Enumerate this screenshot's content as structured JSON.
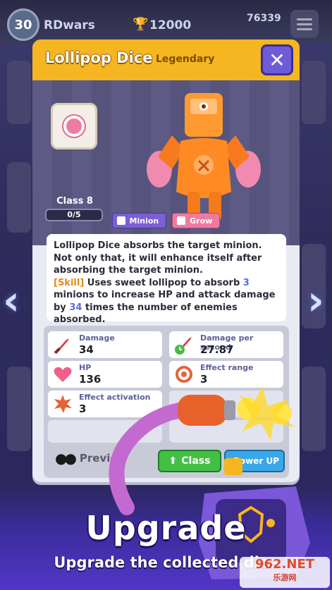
{
  "topbar": {
    "level": "30",
    "player_name": "RDwars",
    "trophies": "12000",
    "coins": "76339",
    "icons": [
      "trophy-icon",
      "coin-icon",
      "menu-icon"
    ]
  },
  "dialog": {
    "title": "Lollipop Dice",
    "rarity": "Legendary",
    "class_label": "Class 8",
    "class_progress": "0/5",
    "progress_fraction": 0,
    "tags": [
      {
        "label": "Minion",
        "color": "#7a5fd8"
      },
      {
        "label": "Grow",
        "color": "#ef7aa0"
      }
    ],
    "description": {
      "line1": "Lollipop Dice absorbs the target minion. Not only that, it will enhance itself after absorbing the target minion.",
      "skill_tag": "[Skill]",
      "skill_pre": " Uses sweet lollipop to absorb ",
      "skill_num1": "3",
      "skill_mid": " minions to increase HP and attack damage by ",
      "skill_num2": "34",
      "skill_post": " times the number of enemies absorbed."
    },
    "stats": [
      {
        "label": "Damage",
        "value": "34",
        "icon": "sword-icon"
      },
      {
        "label": "Damage per second",
        "value": "27.87",
        "icon": "sword-clock-icon"
      },
      {
        "label": "HP",
        "value": "136",
        "icon": "heart-icon"
      },
      {
        "label": "Effect range",
        "value": "3",
        "icon": "target-icon"
      },
      {
        "label": "Effect activation",
        "value": "3",
        "icon": "burst-icon"
      }
    ],
    "buttons": {
      "preview": "Preview",
      "class": "Class",
      "power_up": "Power UP"
    }
  },
  "banner": {
    "title": "Upgrade",
    "subtitle": "Upgrade the collected dice"
  },
  "watermark": {
    "main": "962.NET",
    "sub": "乐游网"
  },
  "colors": {
    "header": "#f5b622",
    "close_button": "#6d5bd8",
    "class_button": "#43c043",
    "power_button": "#3aa7e8",
    "skill_highlight": "#e08a1a",
    "number_highlight": "#5a6be0"
  }
}
